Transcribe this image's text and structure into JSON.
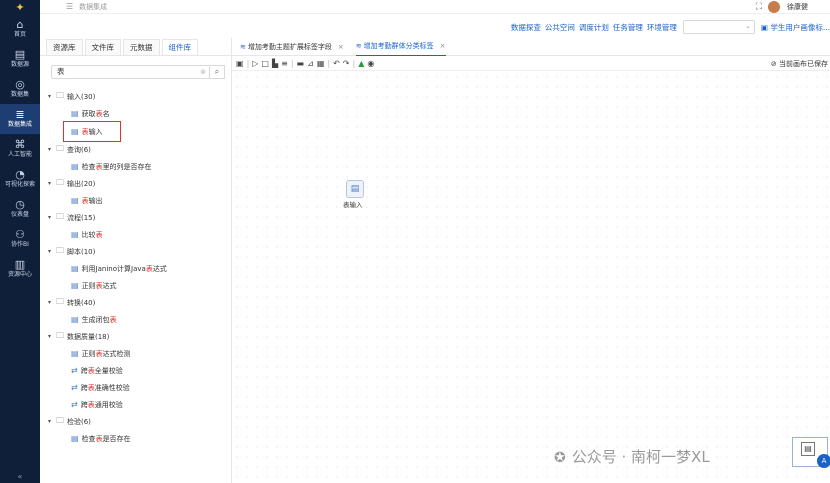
{
  "rail": {
    "items": [
      {
        "icon": "home-icon",
        "glyph": "⌂",
        "label": "首页"
      },
      {
        "icon": "datasource-icon",
        "glyph": "▤",
        "label": "数据源"
      },
      {
        "icon": "dataset-icon",
        "glyph": "◎",
        "label": "数据集"
      },
      {
        "icon": "integration-icon",
        "glyph": "≣",
        "label": "数据集成"
      },
      {
        "icon": "ai-icon",
        "glyph": "⌘",
        "label": "人工智能"
      },
      {
        "icon": "visual-icon",
        "glyph": "◔",
        "label": "可视化探索"
      },
      {
        "icon": "dashboard-icon",
        "glyph": "◷",
        "label": "仪表盘"
      },
      {
        "icon": "graph-icon",
        "glyph": "⚇",
        "label": "协作BI"
      },
      {
        "icon": "resource-icon",
        "glyph": "▥",
        "label": "资源中心"
      }
    ],
    "active_index": 3
  },
  "topbar": {
    "breadcrumb": "数据集成",
    "username": "徐康健"
  },
  "navbar": {
    "links": [
      "数据探查",
      "公共空间",
      "调度计划",
      "任务管理",
      "环境管理"
    ],
    "select_value": "",
    "screen_link": "学生用户画像标..."
  },
  "panel": {
    "tabs": [
      "资源库",
      "文件库",
      "元数据",
      "组件库"
    ],
    "active_tab": 3,
    "search_value": "表"
  },
  "tree": [
    {
      "type": "group",
      "label": "输入(30)"
    },
    {
      "type": "leaf",
      "icon": "table-icon",
      "glyph": "▤",
      "pre": "获取 ",
      "hl": "表",
      "post": " 名"
    },
    {
      "type": "leaf",
      "icon": "table-input-icon",
      "glyph": "▤",
      "pre": "",
      "hl": "表",
      "post": " 输入",
      "boxed": true
    },
    {
      "type": "group",
      "label": "查询(6)"
    },
    {
      "type": "leaf",
      "icon": "check-icon",
      "glyph": "▤",
      "pre": "检查 ",
      "hl": "表",
      "post": " 里的列是否存在"
    },
    {
      "type": "group",
      "label": "输出(20)"
    },
    {
      "type": "leaf",
      "icon": "table-output-icon",
      "glyph": "▤",
      "pre": "",
      "hl": "表",
      "post": " 输出"
    },
    {
      "type": "group",
      "label": "流程(15)"
    },
    {
      "type": "leaf",
      "icon": "compare-icon",
      "glyph": "▤",
      "pre": "比较 ",
      "hl": "表",
      "post": ""
    },
    {
      "type": "group",
      "label": "脚本(10)"
    },
    {
      "type": "leaf",
      "icon": "script-icon",
      "glyph": "▤",
      "pre": "利用Janino计算Java ",
      "hl": "表",
      "post": " 达式"
    },
    {
      "type": "leaf",
      "icon": "regex-icon",
      "glyph": "▤",
      "pre": "正则 ",
      "hl": "表",
      "post": " 达式"
    },
    {
      "type": "group",
      "label": "转换(40)"
    },
    {
      "type": "leaf",
      "icon": "closure-icon",
      "glyph": "▤",
      "pre": "生成闭包 ",
      "hl": "表",
      "post": ""
    },
    {
      "type": "group",
      "label": "数据质量(18)"
    },
    {
      "type": "leaf",
      "icon": "regex-check-icon",
      "glyph": "▤",
      "pre": "正则 ",
      "hl": "表",
      "post": " 达式检测"
    },
    {
      "type": "leaf",
      "icon": "cross-check-icon",
      "glyph": "⇄",
      "pre": "跨 ",
      "hl": "表",
      "post": " 全量校验"
    },
    {
      "type": "leaf",
      "icon": "cross-accuracy-icon",
      "glyph": "⇄",
      "pre": "跨 ",
      "hl": "表",
      "post": " 准确性校验"
    },
    {
      "type": "leaf",
      "icon": "cross-general-icon",
      "glyph": "⇄",
      "pre": "跨 ",
      "hl": "表",
      "post": " 通用校验"
    },
    {
      "type": "group",
      "label": "检验(6)"
    },
    {
      "type": "leaf",
      "icon": "exist-check-icon",
      "glyph": "▤",
      "pre": "检查 ",
      "hl": "表",
      "post": " 是否存在"
    }
  ],
  "editor": {
    "tabs": [
      {
        "label": "增加考勤主题扩展标签字段",
        "active": false
      },
      {
        "label": "增加考勤群体分类标签",
        "active": true
      }
    ],
    "saved_text": "当前画布已保存",
    "canvas_node_label": "表输入"
  },
  "watermark": {
    "text": "公众号 · 南柯一梦XL"
  }
}
